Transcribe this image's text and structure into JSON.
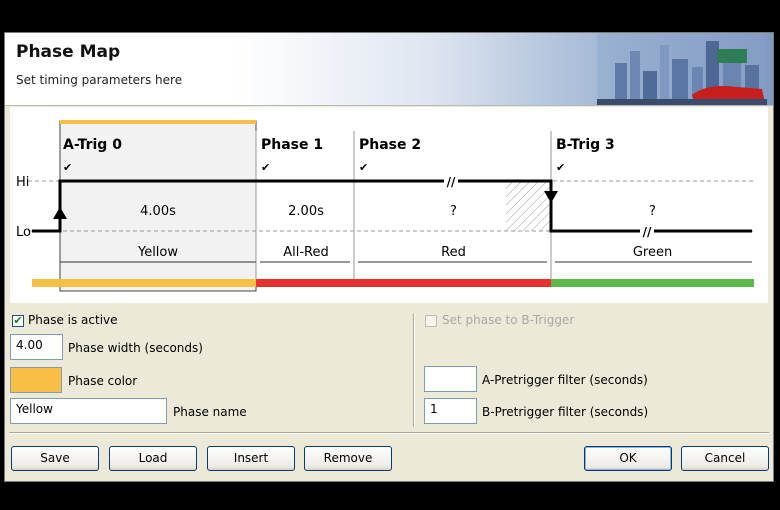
{
  "header": {
    "title": "Phase Map",
    "subtitle": "Set timing parameters here"
  },
  "diagram": {
    "hi_label": "Hi",
    "lo_label": "Lo",
    "break_mark": "//",
    "check_mark": "✔",
    "phases": [
      {
        "name": "A-Trig 0",
        "duration": "4.00s",
        "color_name": "Yellow",
        "bar_color": "#f7bf45",
        "selected": true
      },
      {
        "name": "Phase 1",
        "duration": "2.00s",
        "color_name": "All-Red",
        "bar_color": "#e8312e",
        "selected": false
      },
      {
        "name": "Phase 2",
        "duration": "?",
        "color_name": "Red",
        "bar_color": "#e8312e",
        "selected": false
      },
      {
        "name": "B-Trig 3",
        "duration": "?",
        "color_name": "Green",
        "bar_color": "#5ab94a",
        "selected": false
      }
    ]
  },
  "form": {
    "active_label": "Phase is active",
    "active_checked": true,
    "width_value": "4.00",
    "width_label": "Phase width (seconds)",
    "color_label": "Phase color",
    "color_value": "#f7bf45",
    "name_value": "Yellow",
    "name_label": "Phase name",
    "btrigger_label": "Set phase to B-Trigger",
    "btrigger_checked": false,
    "a_filter_value": "",
    "a_filter_label": "A-Pretrigger filter (seconds)",
    "b_filter_value": "1",
    "b_filter_label": "B-Pretrigger filter (seconds)"
  },
  "buttons": {
    "save": "Save",
    "load": "Load",
    "insert": "Insert",
    "remove": "Remove",
    "ok": "OK",
    "cancel": "Cancel"
  }
}
